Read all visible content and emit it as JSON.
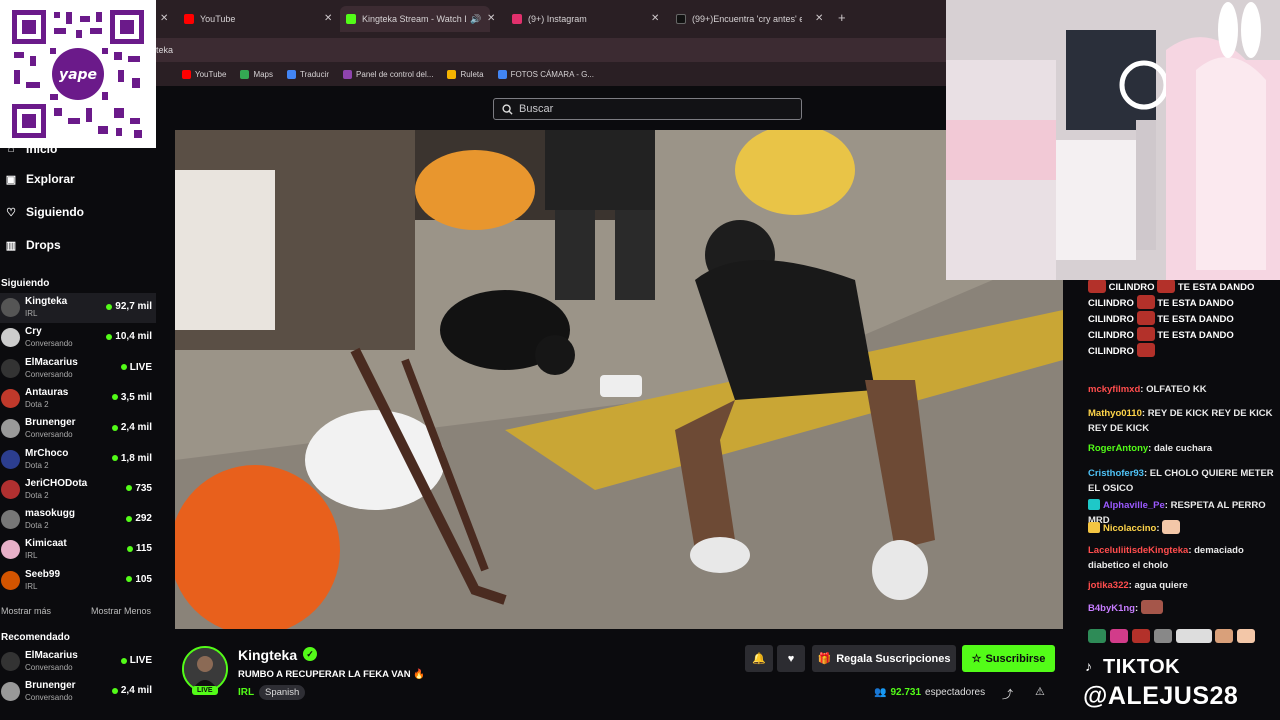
{
  "browser": {
    "tabs": [
      {
        "title": "YouTube",
        "color": "#ff0000"
      },
      {
        "title": "Kingteka Stream - Watch Li...",
        "color": "#53fc18"
      },
      {
        "title": "(9+) Instagram",
        "color": "#e1306c"
      },
      {
        "title": "(99+)Encuentra 'cry antes' en T...",
        "color": "#111111"
      }
    ],
    "url": "teka",
    "bookmarks": [
      {
        "label": "YouTube",
        "color": "#ff0000"
      },
      {
        "label": "Maps",
        "color": "#34a853"
      },
      {
        "label": "Traducir",
        "color": "#4285f4"
      },
      {
        "label": "Panel de control del...",
        "color": "#8e44ad"
      },
      {
        "label": "Ruleta",
        "color": "#f4b400"
      },
      {
        "label": "FOTOS CÁMARA - G...",
        "color": "#4285f4"
      }
    ]
  },
  "qr": {
    "logo_text": "yape"
  },
  "sidebar": {
    "nav": [
      {
        "label": "Inicio",
        "icon": "home-icon"
      },
      {
        "label": "Explorar",
        "icon": "compass-icon"
      },
      {
        "label": "Siguiendo",
        "icon": "heart-icon"
      },
      {
        "label": "Drops",
        "icon": "drops-icon"
      }
    ],
    "following_title": "Siguiendo",
    "following": [
      {
        "name": "Kingteka",
        "category": "IRL",
        "viewers": "92,7 mil",
        "color": "#555"
      },
      {
        "name": "Cry",
        "category": "Conversando",
        "viewers": "10,4 mil",
        "color": "#ccc"
      },
      {
        "name": "ElMacarius",
        "category": "Conversando",
        "viewers": "LIVE",
        "color": "#333"
      },
      {
        "name": "Antauras",
        "category": "Dota 2",
        "viewers": "3,5 mil",
        "color": "#c0392b"
      },
      {
        "name": "Brunenger",
        "category": "Conversando",
        "viewers": "2,4 mil",
        "color": "#999"
      },
      {
        "name": "MrChoco",
        "category": "Dota 2",
        "viewers": "1,8 mil",
        "color": "#2c3e8f"
      },
      {
        "name": "JeriCHODota",
        "category": "Dota 2",
        "viewers": "735",
        "color": "#b03030"
      },
      {
        "name": "masokugg",
        "category": "Dota 2",
        "viewers": "292",
        "color": "#777"
      },
      {
        "name": "Kimicaat",
        "category": "IRL",
        "viewers": "115",
        "color": "#e8b0c8"
      },
      {
        "name": "Seeb99",
        "category": "IRL",
        "viewers": "105",
        "color": "#d35400"
      }
    ],
    "show_more": "Mostrar más",
    "show_less": "Mostrar Menos",
    "recommended_title": "Recomendado",
    "recommended": [
      {
        "name": "ElMacarius",
        "category": "Conversando",
        "viewers": "LIVE",
        "color": "#333"
      },
      {
        "name": "Brunenger",
        "category": "Conversando",
        "viewers": "2,4 mil",
        "color": "#999"
      }
    ]
  },
  "search": {
    "placeholder": "Buscar"
  },
  "stream": {
    "streamer": "Kingteka",
    "title": "RUMBO A RECUPERAR LA FEKA VAN 🔥",
    "category": "IRL",
    "language": "Spanish",
    "live_label": "LIVE",
    "viewers": "92.731",
    "viewers_label": "espectadores",
    "gift_label": "Regala Suscripciones",
    "subscribe_label": "Suscribirse"
  },
  "chat": {
    "spam_top": "CILINDRO",
    "spam_phrase": "TE ESTA DANDO CILINDRO",
    "messages": [
      {
        "user": "mckyfilmxd",
        "color": "#ff4d4d",
        "text": "OLFATEO KK"
      },
      {
        "user": "Mathyo0110",
        "color": "#ffd54a",
        "text": "REY DE KICK REY DE KICK REY DE KICK"
      },
      {
        "user": "RogerAntony",
        "color": "#53fc18",
        "text": "dale cuchara"
      },
      {
        "user": "Cristhofer93",
        "color": "#4fc3f7",
        "text": "EL CHOLO QUIERE METER EL OSICO"
      },
      {
        "user": "Alphaville_Pe",
        "color": "#9b59ff",
        "text": "RESPETA AL PERRO MRD"
      },
      {
        "user": "Nicolaccino",
        "color": "#ffd54a",
        "text": ""
      },
      {
        "user": "LaceluliitisdeKingteka",
        "color": "#ff4d4d",
        "text": "demaciado diabetico el cholo"
      },
      {
        "user": "jotika322",
        "color": "#ff4d4d",
        "text": "agua quiere"
      },
      {
        "user": "B4byK1ng",
        "color": "#c77dff",
        "text": ""
      }
    ]
  },
  "overlay": {
    "tiktok_label": "TIKTOK",
    "tiktok_handle": "@ALEJUS28"
  }
}
